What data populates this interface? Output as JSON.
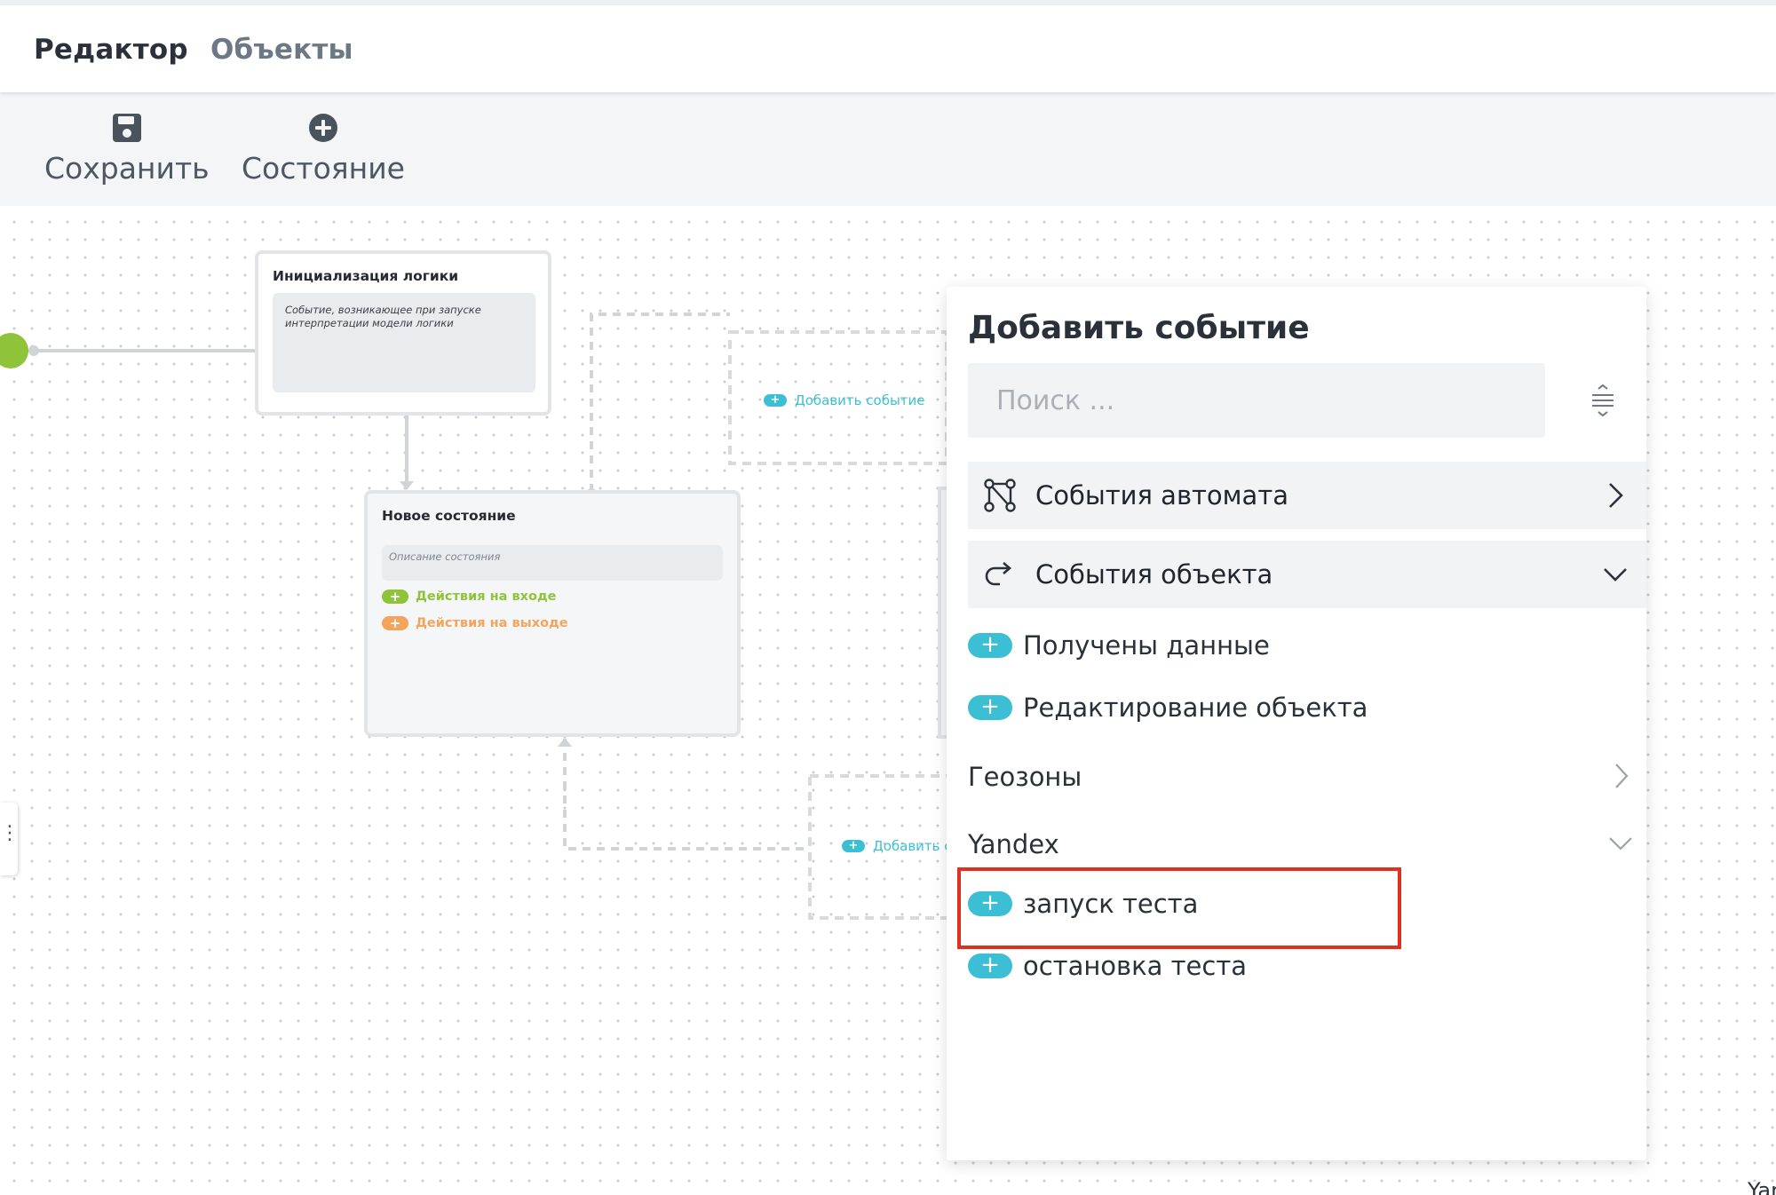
{
  "nav": {
    "tabs": [
      {
        "label": "Редактор",
        "active": true
      },
      {
        "label": "Объекты",
        "active": false
      }
    ]
  },
  "toolbar": {
    "save_label": "Сохранить",
    "save_icon": "floppy-disk-icon",
    "state_label": "Состояние",
    "state_icon": "plus-circle-icon"
  },
  "canvas": {
    "init_node": {
      "title": "Инициализация логики",
      "description": "Событие, возникающее при запуске интерпретации модели логики"
    },
    "state_node": {
      "title": "Новое состояние",
      "description_placeholder": "Описание состояния",
      "enter_actions": "Действия на входе",
      "exit_actions": "Действия на выходе"
    },
    "add_event_label": "Добавить событие",
    "add_event_label_clipped": "Добавить со",
    "corner_text": "Yar"
  },
  "panel": {
    "title": "Добавить событие",
    "search_placeholder": "Поиск ...",
    "groups": [
      {
        "label": "События автомата",
        "icon": "state-machine-icon",
        "expanded": false
      },
      {
        "label": "События объекта",
        "icon": "redo-arrow-icon",
        "expanded": true
      }
    ],
    "object_events": [
      "Получены данные",
      "Редактирование объекта"
    ],
    "subgroups": [
      {
        "label": "Геозоны",
        "expanded": false
      },
      {
        "label": "Yandex",
        "expanded": true
      }
    ],
    "yandex_events": [
      "запуск теста",
      "остановка теста"
    ],
    "highlighted_item": "запуск теста"
  },
  "colors": {
    "accent_teal": "#3cbfd4",
    "enter_green": "#8fc43a",
    "exit_orange": "#f4a45c",
    "highlight_red": "#e0301e"
  }
}
